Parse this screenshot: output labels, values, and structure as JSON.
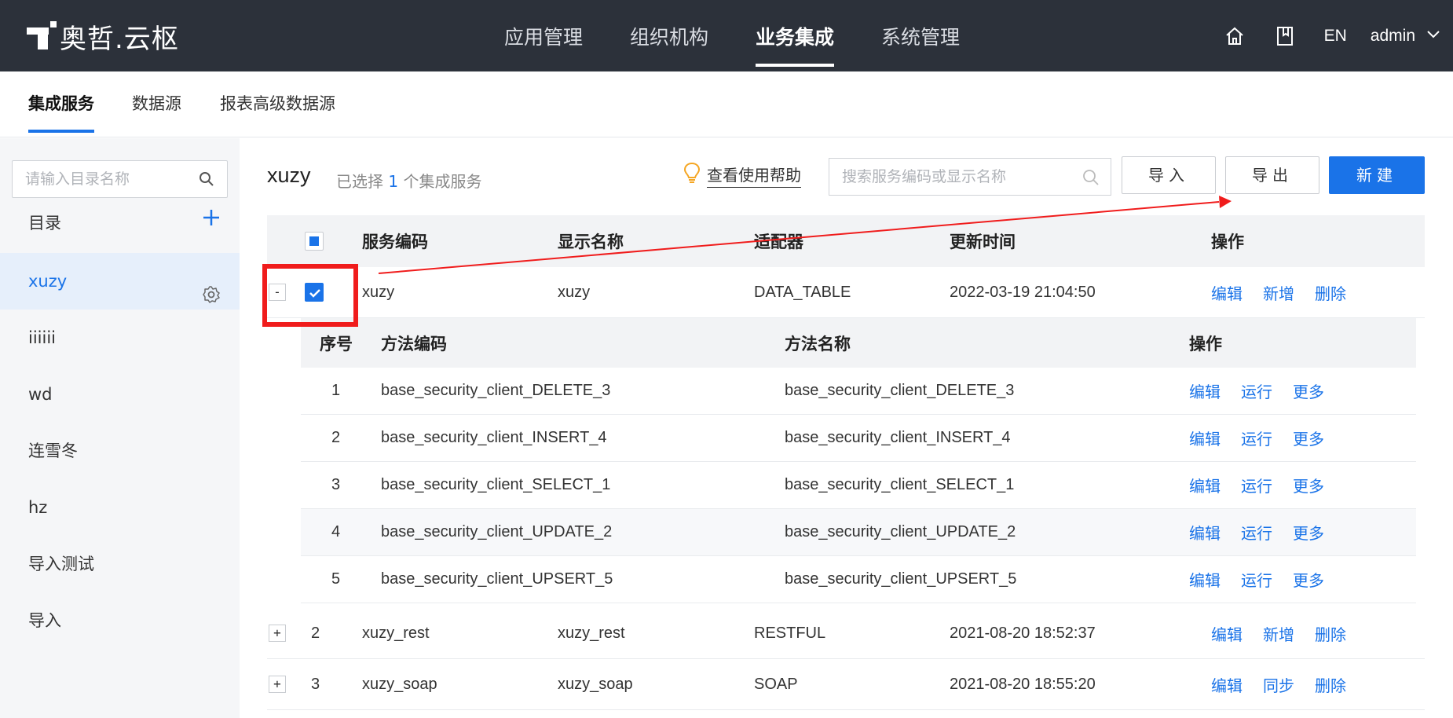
{
  "brand": {
    "name": "奥哲.云枢"
  },
  "topnav": {
    "items": [
      "应用管理",
      "组织机构",
      "业务集成",
      "系统管理"
    ],
    "active_index": 2,
    "lang": "EN",
    "user": "admin"
  },
  "subtabs": {
    "items": [
      "集成服务",
      "数据源",
      "报表高级数据源"
    ],
    "active_index": 0
  },
  "sidebar": {
    "search_placeholder": "请输入目录名称",
    "heading": "目录",
    "items": [
      "xuzy",
      "iiiiii",
      "wd",
      "连雪冬",
      "hz",
      "导入测试",
      "导入"
    ],
    "active_index": 0
  },
  "header": {
    "dir_title": "xuzy",
    "selected_prefix": "已选择",
    "selected_count": "1",
    "selected_suffix": "个集成服务",
    "help": "查看使用帮助",
    "search_placeholder": "搜索服务编码或显示名称",
    "import": "导入",
    "export": "导出",
    "new": "新建"
  },
  "table": {
    "columns": [
      "服务编码",
      "显示名称",
      "适配器",
      "更新时间",
      "操作"
    ],
    "rows": [
      {
        "index": "",
        "expander": "-",
        "checked": true,
        "code": "xuzy",
        "name": "xuzy",
        "adapter": "DATA_TABLE",
        "updated": "2022-03-19 21:04:50",
        "actions": [
          "编辑",
          "新增",
          "删除"
        ]
      },
      {
        "index": "2",
        "expander": "+",
        "checked": false,
        "code": "xuzy_rest",
        "name": "xuzy_rest",
        "adapter": "RESTFUL",
        "updated": "2021-08-20 18:52:37",
        "actions": [
          "编辑",
          "新增",
          "删除"
        ]
      },
      {
        "index": "3",
        "expander": "+",
        "checked": false,
        "code": "xuzy_soap",
        "name": "xuzy_soap",
        "adapter": "SOAP",
        "updated": "2021-08-20 18:55:20",
        "actions": [
          "编辑",
          "同步",
          "删除"
        ]
      }
    ]
  },
  "subtable": {
    "columns": [
      "序号",
      "方法编码",
      "方法名称",
      "操作"
    ],
    "rows": [
      {
        "no": "1",
        "code": "base_security_client_DELETE_3",
        "name": "base_security_client_DELETE_3",
        "actions": [
          "编辑",
          "运行",
          "更多"
        ]
      },
      {
        "no": "2",
        "code": "base_security_client_INSERT_4",
        "name": "base_security_client_INSERT_4",
        "actions": [
          "编辑",
          "运行",
          "更多"
        ]
      },
      {
        "no": "3",
        "code": "base_security_client_SELECT_1",
        "name": "base_security_client_SELECT_1",
        "actions": [
          "编辑",
          "运行",
          "更多"
        ]
      },
      {
        "no": "4",
        "code": "base_security_client_UPDATE_2",
        "name": "base_security_client_UPDATE_2",
        "actions": [
          "编辑",
          "运行",
          "更多"
        ]
      },
      {
        "no": "5",
        "code": "base_security_client_UPSERT_5",
        "name": "base_security_client_UPSERT_5",
        "actions": [
          "编辑",
          "运行",
          "更多"
        ]
      }
    ]
  },
  "colors": {
    "accent": "#1a73e8",
    "topbar": "#2c313a",
    "annotation": "#f01c1c"
  }
}
